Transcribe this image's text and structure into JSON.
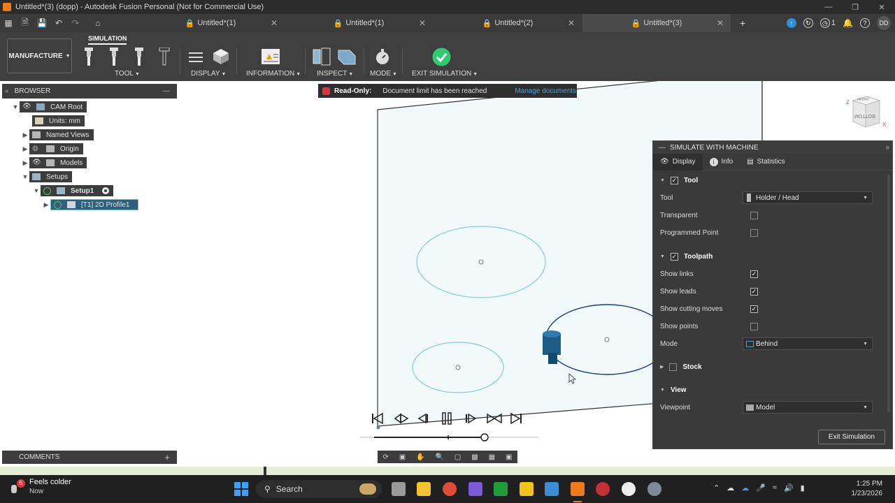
{
  "window": {
    "title": "Untitled*(3) (dopp) - Autodesk Fusion Personal (Not for Commercial Use)"
  },
  "tabs": [
    {
      "label": "Untitled*(1)"
    },
    {
      "label": "Untitled*(1)"
    },
    {
      "label": "Untitled*(2)"
    },
    {
      "label": "Untitled*(3)"
    }
  ],
  "header_right": {
    "notif_count": "1",
    "user_initials": "DD"
  },
  "toolbar": {
    "workspace": "MANUFACTURE",
    "active_tab": "SIMULATION",
    "groups": {
      "tool": "TOOL",
      "display": "DISPLAY",
      "information": "INFORMATION",
      "inspect": "INSPECT",
      "mode": "MODE",
      "exit": "EXIT SIMULATION"
    }
  },
  "browser": {
    "title": "BROWSER",
    "items": [
      {
        "label": "CAM Root"
      },
      {
        "label": "Units: mm"
      },
      {
        "label": "Named Views"
      },
      {
        "label": "Origin"
      },
      {
        "label": "Models"
      },
      {
        "label": "Setups"
      },
      {
        "label": "Setup1"
      },
      {
        "label": "[T1] 2D Profile1"
      }
    ]
  },
  "banner": {
    "label": "Read-Only:",
    "message": "Document limit has been reached",
    "link": "Manage documents"
  },
  "comments": {
    "title": "COMMENTS"
  },
  "viewcube": {
    "top": "FRONT",
    "side": "BOTTOM",
    "z": "Z",
    "x": "X"
  },
  "sim_panel": {
    "title": "SIMULATE WITH MACHINE",
    "tabs": [
      "Display",
      "Info",
      "Statistics"
    ],
    "tool_section": "Tool",
    "tool_label": "Tool",
    "tool_value": "Holder / Head",
    "transparent": "Transparent",
    "programmed_point": "Programmed Point",
    "toolpath_section": "Toolpath",
    "show_links": "Show links",
    "show_leads": "Show leads",
    "show_cutting": "Show cutting moves",
    "show_points": "Show points",
    "mode_label": "Mode",
    "mode_value": "Behind",
    "stock_section": "Stock",
    "view_section": "View",
    "viewpoint_label": "Viewpoint",
    "viewpoint_value": "Model",
    "exit_button": "Exit Simulation"
  },
  "taskbar": {
    "weather_text": "Feels colder",
    "weather_sub": "Now",
    "weather_badge": "5",
    "search_placeholder": "Search",
    "time": "1:25 PM",
    "date": "1/23/2026"
  },
  "colors": {
    "accent": "#4aa3d6",
    "readonly_red": "#d9363e",
    "check_green": "#2ecc71",
    "path_blue": "#1f3a8a",
    "circle_blue": "#89cdd6"
  }
}
